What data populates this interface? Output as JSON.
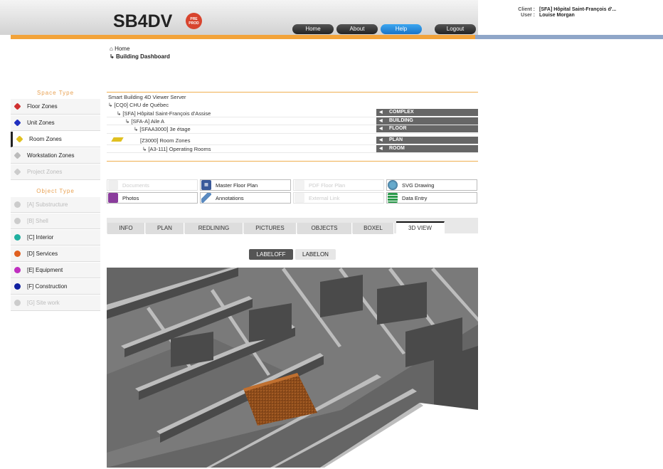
{
  "header": {
    "logo": "SB4DV",
    "badge": "PRE PROD",
    "nav": [
      "Home",
      "About",
      "Help",
      "Logout"
    ],
    "client_label": "Client :",
    "client_value": "[SFA] Hôpital Saint-François d'...",
    "user_label": "User :",
    "user_value": "Louise Morgan"
  },
  "breadcrumb": {
    "home": "Home",
    "current": "Building Dashboard"
  },
  "sidebar": {
    "space_title": "Space Type",
    "space_items": [
      {
        "label": "Floor Zones",
        "color": "#d03030"
      },
      {
        "label": "Unit Zones",
        "color": "#2030c0"
      },
      {
        "label": "Room Zones",
        "color": "#e0c020"
      },
      {
        "label": "Workstation Zones",
        "color": "#bbbbbb"
      },
      {
        "label": "Project Zones",
        "color": "#cccccc"
      }
    ],
    "object_title": "Object Type",
    "object_items": [
      {
        "label": "[A] Substructure",
        "color": "#cccccc"
      },
      {
        "label": "[B] Shell",
        "color": "#cccccc"
      },
      {
        "label": "[C] Interior",
        "color": "#20b0a0"
      },
      {
        "label": "[D] Services",
        "color": "#e06020"
      },
      {
        "label": "[E] Equipment",
        "color": "#c030c0"
      },
      {
        "label": "[F] Construction",
        "color": "#1020a0"
      },
      {
        "label": "[G] Site work",
        "color": "#cccccc"
      }
    ]
  },
  "tree": {
    "server": "Smart Building 4D Viewer Server",
    "complex": "[CQ0] CHU de Québec",
    "building": "[SFA] Hôpital Saint-François d'Assise",
    "wing": "[SFA-A] Aile A",
    "floor": "[SFAA3000] 3e étage",
    "zone": "[Z3000] Room Zones",
    "room": "[A3-111] Operating Rooms",
    "levels": [
      "COMPLEX",
      "BUILDING",
      "FLOOR",
      "PLAN",
      "ROOM"
    ]
  },
  "docs": {
    "documents": "Documents",
    "master_plan": "Master Floor Plan",
    "pdf_plan": "PDF Floor Plan",
    "svg_drawing": "SVG Drawing",
    "photos": "Photos",
    "annotations": "Annotations",
    "external_link": "External Link",
    "data_entry": "Data Entry"
  },
  "tabs": [
    "INFO",
    "PLAN",
    "REDLINING",
    "PICTURES",
    "OBJECTS",
    "BOXEL",
    "3D VIEW"
  ],
  "labels": {
    "off": "LABELOFF",
    "on": "LABELON"
  }
}
